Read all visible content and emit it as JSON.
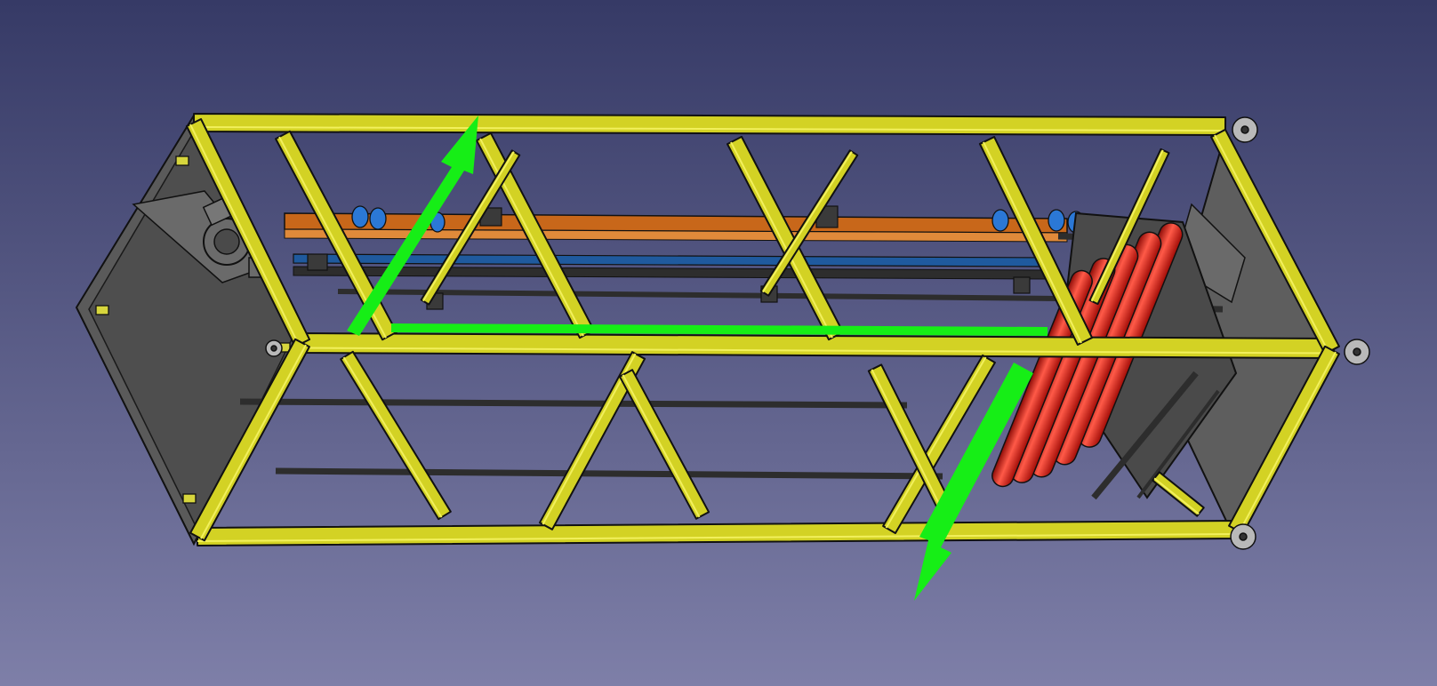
{
  "viewport": {
    "kind": "3d-cad-viewport",
    "background_top": "#363a66",
    "background_bottom": "#7e7fa8"
  },
  "colors": {
    "frame": "#d3d224",
    "frame_highlight": "#f2f05c",
    "frame_shadow": "#8e8a10",
    "outline": "#111111",
    "panel": "#585858",
    "panel_dark": "#3f3f3f",
    "rail_orange": "#c8671a",
    "rail_blue": "#1f5a9e",
    "rail_dark": "#2d2d2d",
    "rollers": "#e4120d",
    "roller_highlight": "#ff7b6b",
    "connector_blue": "#2b78d6",
    "axis_arrow": "#16ee16",
    "feet": "#b9b9b9"
  },
  "icons": {
    "axis": "axis-arrow-icon",
    "foot": "leveling-foot-icon",
    "motor": "motor-icon"
  }
}
